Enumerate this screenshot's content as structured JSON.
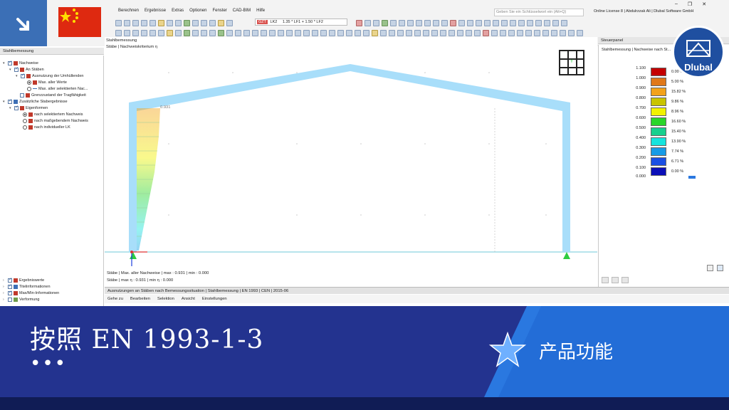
{
  "menu": [
    "Berechnen",
    "Ergebnisse",
    "Extras",
    "Optionen",
    "Fenster",
    "CAD-BIM",
    "Hilfe"
  ],
  "search_placeholder": "Geben Sie ein Schlüsselwort ein (Alt+Q)",
  "license_text": "Online License 8 | Abdulrzzak Ali | Dlubal Software GmbH",
  "load_combo": {
    "tag": "GZT",
    "name": "LK2",
    "formula": "1.35 * LF1 + 1.50 * LF2"
  },
  "navigator": {
    "title": "Stahlbemessung",
    "items": [
      {
        "label": "Nachweise",
        "type": "cb",
        "on": true,
        "level": 0
      },
      {
        "label": "An Stäben",
        "type": "cb",
        "on": true,
        "level": 1
      },
      {
        "label": "Ausnutzung der Umhüllenden",
        "type": "cb",
        "on": true,
        "level": 2
      },
      {
        "label": "Max. aller Werte",
        "type": "rb",
        "on": true,
        "level": 3
      },
      {
        "label": "Max. aller selektierten Nac...",
        "type": "rb",
        "on": false,
        "level": 3
      },
      {
        "label": "Grenzzustand der Tragfähigkeit",
        "type": "cb",
        "on": false,
        "level": 2
      },
      {
        "label": "Zusätzliche Stabergebnisse",
        "type": "cb",
        "on": true,
        "level": 0
      },
      {
        "label": "Eigenformen",
        "type": "cb",
        "on": true,
        "level": 1
      },
      {
        "label": "nach selektiertem Nachweis",
        "type": "rb",
        "on": true,
        "level": 2
      },
      {
        "label": "nach maßgebendem Nachweis",
        "type": "rb",
        "on": false,
        "level": 2
      },
      {
        "label": "nach individueller LK",
        "type": "rb",
        "on": false,
        "level": 2
      }
    ],
    "bottom_items": [
      "Ergebniswerte",
      "Titelinformationen",
      "Max/Min-Informationen",
      "Verformung"
    ]
  },
  "viewport": {
    "header1": "Stahlbemessung",
    "header2": "Stäbe | Nachweiskriterium η",
    "value_label": "0.931",
    "axis_label": "Y",
    "status1": "Stäbe | Max. aller Nachweise | max : 0.931 | min : 0.000",
    "status2": "Stäbe | max η : 0.931 | min η : 0.000"
  },
  "control_panel": {
    "title": "Steuerpanel",
    "subtitle": "Stahlbemessung | Nachweise nach St...",
    "legend": [
      {
        "value": "1.100",
        "color": "#c40000",
        "pct": "0.00 %"
      },
      {
        "value": "1.000",
        "color": "#e0781a",
        "pct": "5.00 %"
      },
      {
        "value": "0.900",
        "color": "#f3a21a",
        "pct": "15.82 %"
      },
      {
        "value": "0.800",
        "color": "#c9c400",
        "pct": "9.86 %"
      },
      {
        "value": "0.700",
        "color": "#f2f200",
        "pct": "8.96 %"
      },
      {
        "value": "0.600",
        "color": "#29d629",
        "pct": "16.60 %"
      },
      {
        "value": "0.500",
        "color": "#17d08e",
        "pct": "15.40 %"
      },
      {
        "value": "0.400",
        "color": "#15e4dd",
        "pct": "13.90 %"
      },
      {
        "value": "0.300",
        "color": "#169be6",
        "pct": "7.74 %"
      },
      {
        "value": "0.200",
        "color": "#1a4fe4",
        "pct": "6.71 %"
      },
      {
        "value": "0.100",
        "color": "#0b0fb8",
        "pct": "0.00 %"
      }
    ],
    "legend_end": "0.000"
  },
  "results": {
    "title": "Ausnutzungen an Stäben nach Bemessungssituation | Stahlbemessung | EN 1993 | CEN | 2015-06",
    "menu": [
      "Gehe zu",
      "Bearbeiten",
      "Selektion",
      "Ansicht",
      "Einstellungen"
    ]
  },
  "banner": {
    "title": "按照 EN 1993-1-3",
    "dots": "•••",
    "feature": "产品功能",
    "logo_text": "Dlubal"
  },
  "colors": {
    "frame": "#a8defa",
    "banner": "#23338f",
    "accent": "#2a78e0"
  }
}
